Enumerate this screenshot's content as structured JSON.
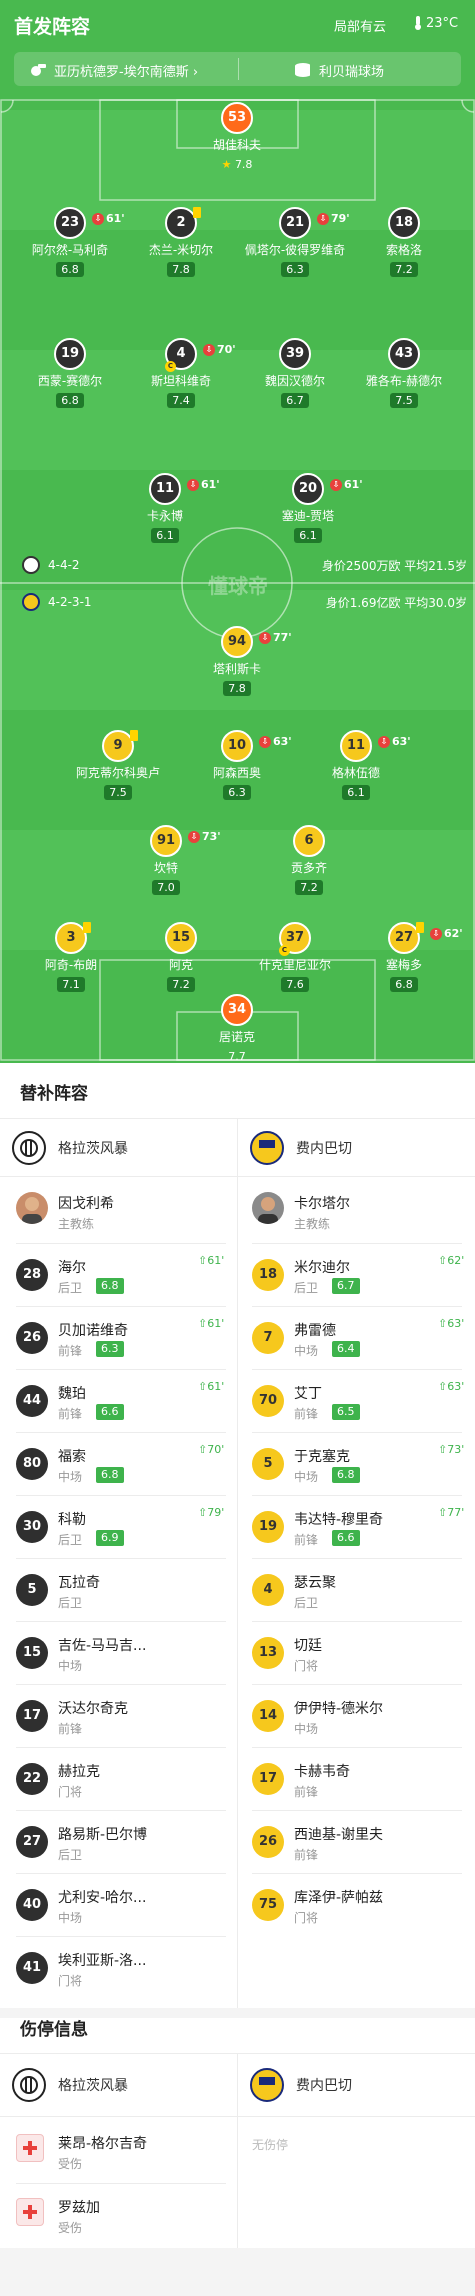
{
  "header": {
    "title": "首发阵容",
    "weather": "局部有云",
    "temperature": "23°C",
    "match": "亚历杭德罗-埃尔南德斯",
    "stadium": "利贝瑞球场"
  },
  "pitch": {
    "watermark": "懂球帝",
    "home_formation": "4-4-2",
    "home_value": "身价2500万欧  平均21.5岁",
    "away_formation": "4-2-3-1",
    "away_value": "身价1.69亿欧  平均30.0岁",
    "home_players": [
      {
        "num": "53",
        "name": "胡佳科夫",
        "rating": "7.8"
      },
      {
        "num": "23",
        "name": "阿尔然-马利奇",
        "rating": "6.8",
        "ev": "61'"
      },
      {
        "num": "2",
        "name": "杰兰-米切尔",
        "rating": "7.8"
      },
      {
        "num": "21",
        "name": "佩塔尔-彼得罗维奇",
        "rating": "6.3",
        "ev": "79'"
      },
      {
        "num": "18",
        "name": "索格洛",
        "rating": "7.2"
      },
      {
        "num": "19",
        "name": "西蒙-赛德尔",
        "rating": "6.8"
      },
      {
        "num": "4",
        "name": "斯坦科维奇",
        "rating": "7.4",
        "ev": "70'"
      },
      {
        "num": "39",
        "name": "魏因汉德尔",
        "rating": "6.7"
      },
      {
        "num": "43",
        "name": "雅各布-赫德尔",
        "rating": "7.5"
      },
      {
        "num": "11",
        "name": "卡永博",
        "rating": "6.1",
        "ev": "61'"
      },
      {
        "num": "20",
        "name": "塞迪-贾塔",
        "rating": "6.1",
        "ev": "61'"
      }
    ],
    "away_players": [
      {
        "num": "94",
        "name": "塔利斯卡",
        "rating": "7.8",
        "ev": "77'"
      },
      {
        "num": "9",
        "name": "阿克蒂尔科奥卢",
        "rating": "7.5"
      },
      {
        "num": "10",
        "name": "阿森西奥",
        "rating": "6.3",
        "ev": "63'"
      },
      {
        "num": "11",
        "name": "格林伍德",
        "rating": "6.1",
        "ev": "63'"
      },
      {
        "num": "91",
        "name": "坎特",
        "rating": "7.0",
        "ev": "73'"
      },
      {
        "num": "6",
        "name": "贡多齐",
        "rating": "7.2"
      },
      {
        "num": "3",
        "name": "阿奇-布朗",
        "rating": "7.1"
      },
      {
        "num": "15",
        "name": "阿克",
        "rating": "7.2"
      },
      {
        "num": "37",
        "name": "什克里尼亚尔",
        "rating": "7.6"
      },
      {
        "num": "27",
        "name": "塞梅多",
        "rating": "6.8",
        "ev": "62'"
      },
      {
        "num": "34",
        "name": "居诺克",
        "rating": "7.7"
      }
    ]
  },
  "subs": {
    "title": "替补阵容",
    "home_team": "格拉茨风暴",
    "away_team": "费内巴切",
    "home_coach": {
      "name": "因戈利希",
      "role": "主教练"
    },
    "away_coach": {
      "name": "卡尔塔尔",
      "role": "主教练"
    },
    "home": [
      {
        "num": "28",
        "name": "海尔",
        "pos": "后卫",
        "rating": "6.8",
        "min": "61'"
      },
      {
        "num": "26",
        "name": "贝加诺维奇",
        "pos": "前锋",
        "rating": "6.3",
        "min": "61'"
      },
      {
        "num": "44",
        "name": "魏珀",
        "pos": "前锋",
        "rating": "6.6",
        "min": "61'"
      },
      {
        "num": "80",
        "name": "福索",
        "pos": "中场",
        "rating": "6.8",
        "min": "70'"
      },
      {
        "num": "30",
        "name": "科勒",
        "pos": "后卫",
        "rating": "6.9",
        "min": "79'"
      },
      {
        "num": "5",
        "name": "瓦拉奇",
        "pos": "后卫"
      },
      {
        "num": "15",
        "name": "吉佐-马马吉...",
        "pos": "中场"
      },
      {
        "num": "17",
        "name": "沃达尔奇克",
        "pos": "前锋"
      },
      {
        "num": "22",
        "name": "赫拉克",
        "pos": "门将"
      },
      {
        "num": "27",
        "name": "路易斯-巴尔博",
        "pos": "后卫"
      },
      {
        "num": "40",
        "name": "尤利安-哈尔...",
        "pos": "中场"
      },
      {
        "num": "41",
        "name": "埃利亚斯-洛...",
        "pos": "门将"
      }
    ],
    "away": [
      {
        "num": "18",
        "name": "米尔迪尔",
        "pos": "后卫",
        "rating": "6.7",
        "min": "62'"
      },
      {
        "num": "7",
        "name": "弗雷德",
        "pos": "中场",
        "rating": "6.4",
        "min": "63'"
      },
      {
        "num": "70",
        "name": "艾丁",
        "pos": "前锋",
        "rating": "6.5",
        "min": "63'"
      },
      {
        "num": "5",
        "name": "于克塞克",
        "pos": "中场",
        "rating": "6.8",
        "min": "73'"
      },
      {
        "num": "19",
        "name": "韦达特-穆里奇",
        "pos": "前锋",
        "rating": "6.6",
        "min": "77'"
      },
      {
        "num": "4",
        "name": "瑟云聚",
        "pos": "后卫"
      },
      {
        "num": "13",
        "name": "切廷",
        "pos": "门将"
      },
      {
        "num": "14",
        "name": "伊伊特-德米尔",
        "pos": "中场"
      },
      {
        "num": "17",
        "name": "卡赫韦奇",
        "pos": "前锋"
      },
      {
        "num": "26",
        "name": "西迪基-谢里夫",
        "pos": "前锋"
      },
      {
        "num": "75",
        "name": "库泽伊-萨帕兹",
        "pos": "门将"
      }
    ]
  },
  "injuries": {
    "title": "伤停信息",
    "home_team": "格拉茨风暴",
    "away_team": "费内巴切",
    "home": [
      {
        "name": "莱昂-格尔吉奇",
        "status": "受伤"
      },
      {
        "name": "罗兹加",
        "status": "受伤"
      }
    ],
    "away_none": "无伤停"
  },
  "colors": {
    "pitch": "#49b94f",
    "home_kit": "#2f2f2f",
    "away_kit": "#f6c81d",
    "gk": "#ff6a1a",
    "rating_green": "#3eb34c"
  }
}
